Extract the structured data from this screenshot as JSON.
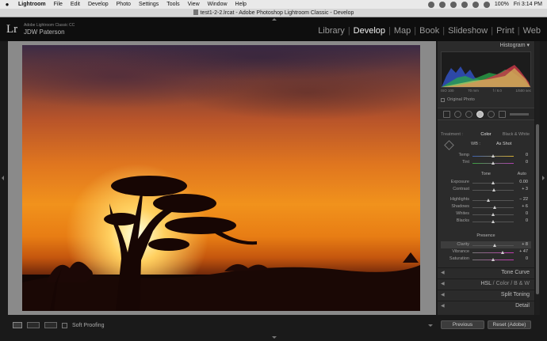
{
  "menubar": {
    "apple": "",
    "app_name": "Lightroom",
    "items": [
      "File",
      "Edit",
      "Develop",
      "Photo",
      "Settings",
      "Tools",
      "View",
      "Window",
      "Help"
    ],
    "battery": "100%",
    "time": "Fri 3:14 PM"
  },
  "window": {
    "title": "test1-2-2.lrcat - Adobe Photoshop Lightroom Classic - Develop"
  },
  "identity": {
    "logo": "Lr",
    "version": "Adobe Lightroom Classic CC",
    "user": "JDW Paterson"
  },
  "modules": {
    "items": [
      "Library",
      "Develop",
      "Map",
      "Book",
      "Slideshow",
      "Print",
      "Web"
    ],
    "active": "Develop",
    "separator": "|"
  },
  "histogram": {
    "title": "Histogram",
    "iso": "ISO 100",
    "focal": "70 mm",
    "aperture": "f / 8.0",
    "shutter": "1/500 sec",
    "original_label": "Original Photo"
  },
  "basic": {
    "treatment_label": "Treatment :",
    "treatment_color": "Color",
    "treatment_bw": "Black & White",
    "wb_label": "WB :",
    "wb_value": "As Shot",
    "temp_label": "Temp",
    "temp_value": "0",
    "tint_label": "Tint",
    "tint_value": "0",
    "tone_label": "Tone",
    "auto_label": "Auto",
    "exposure_label": "Exposure",
    "exposure_value": "0.00",
    "contrast_label": "Contrast",
    "contrast_value": "+ 3",
    "highlights_label": "Highlights",
    "highlights_value": "− 22",
    "shadows_label": "Shadows",
    "shadows_value": "+ 6",
    "whites_label": "Whites",
    "whites_value": "0",
    "blacks_label": "Blacks",
    "blacks_value": "0",
    "presence_label": "Presence",
    "clarity_label": "Clarity",
    "clarity_value": "+ 8",
    "vibrance_label": "Vibrance",
    "vibrance_value": "+ 47",
    "saturation_label": "Saturation",
    "saturation_value": "0"
  },
  "panels": {
    "tone_curve": "Tone Curve",
    "hsl": "HSL",
    "hsl_sep": "/",
    "hsl_color": "Color",
    "hsl_bw": "B & W",
    "split_toning": "Split Toning",
    "detail": "Detail"
  },
  "toolbar": {
    "soft_proofing": "Soft Proofing"
  },
  "buttons": {
    "previous": "Previous",
    "reset": "Reset (Adobe)"
  },
  "colors": {
    "panel_bg": "#2b2b2b",
    "accent_text": "#f0f0f0",
    "photo_sky": "#f1921c"
  }
}
